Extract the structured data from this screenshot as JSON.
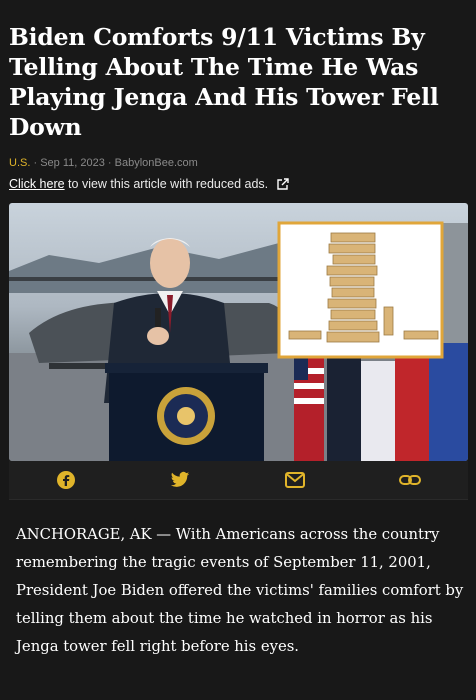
{
  "article": {
    "headline": "Biden Comforts 9/11 Victims By Telling About The Time He Was Playing Jenga And His Tower Fell Down",
    "category": "U.S.",
    "separator": "·",
    "date": "Sep 11, 2023",
    "source": "BabylonBee.com",
    "ads_link": "Click here",
    "ads_text": " to view this article with reduced ads.",
    "body": "ANCHORAGE, AK — With Americans across the country remembering the tragic events of September 11, 2001, President Joe Biden offered the victims' families comfort by telling them about the time he watched in horror as his Jenga tower fell right before his eyes."
  },
  "share": {
    "icons": [
      "facebook-icon",
      "twitter-icon",
      "email-icon",
      "link-icon"
    ]
  },
  "colors": {
    "background": "#181818",
    "accent": "#e0b42a",
    "inset_border": "#e0a63a"
  }
}
